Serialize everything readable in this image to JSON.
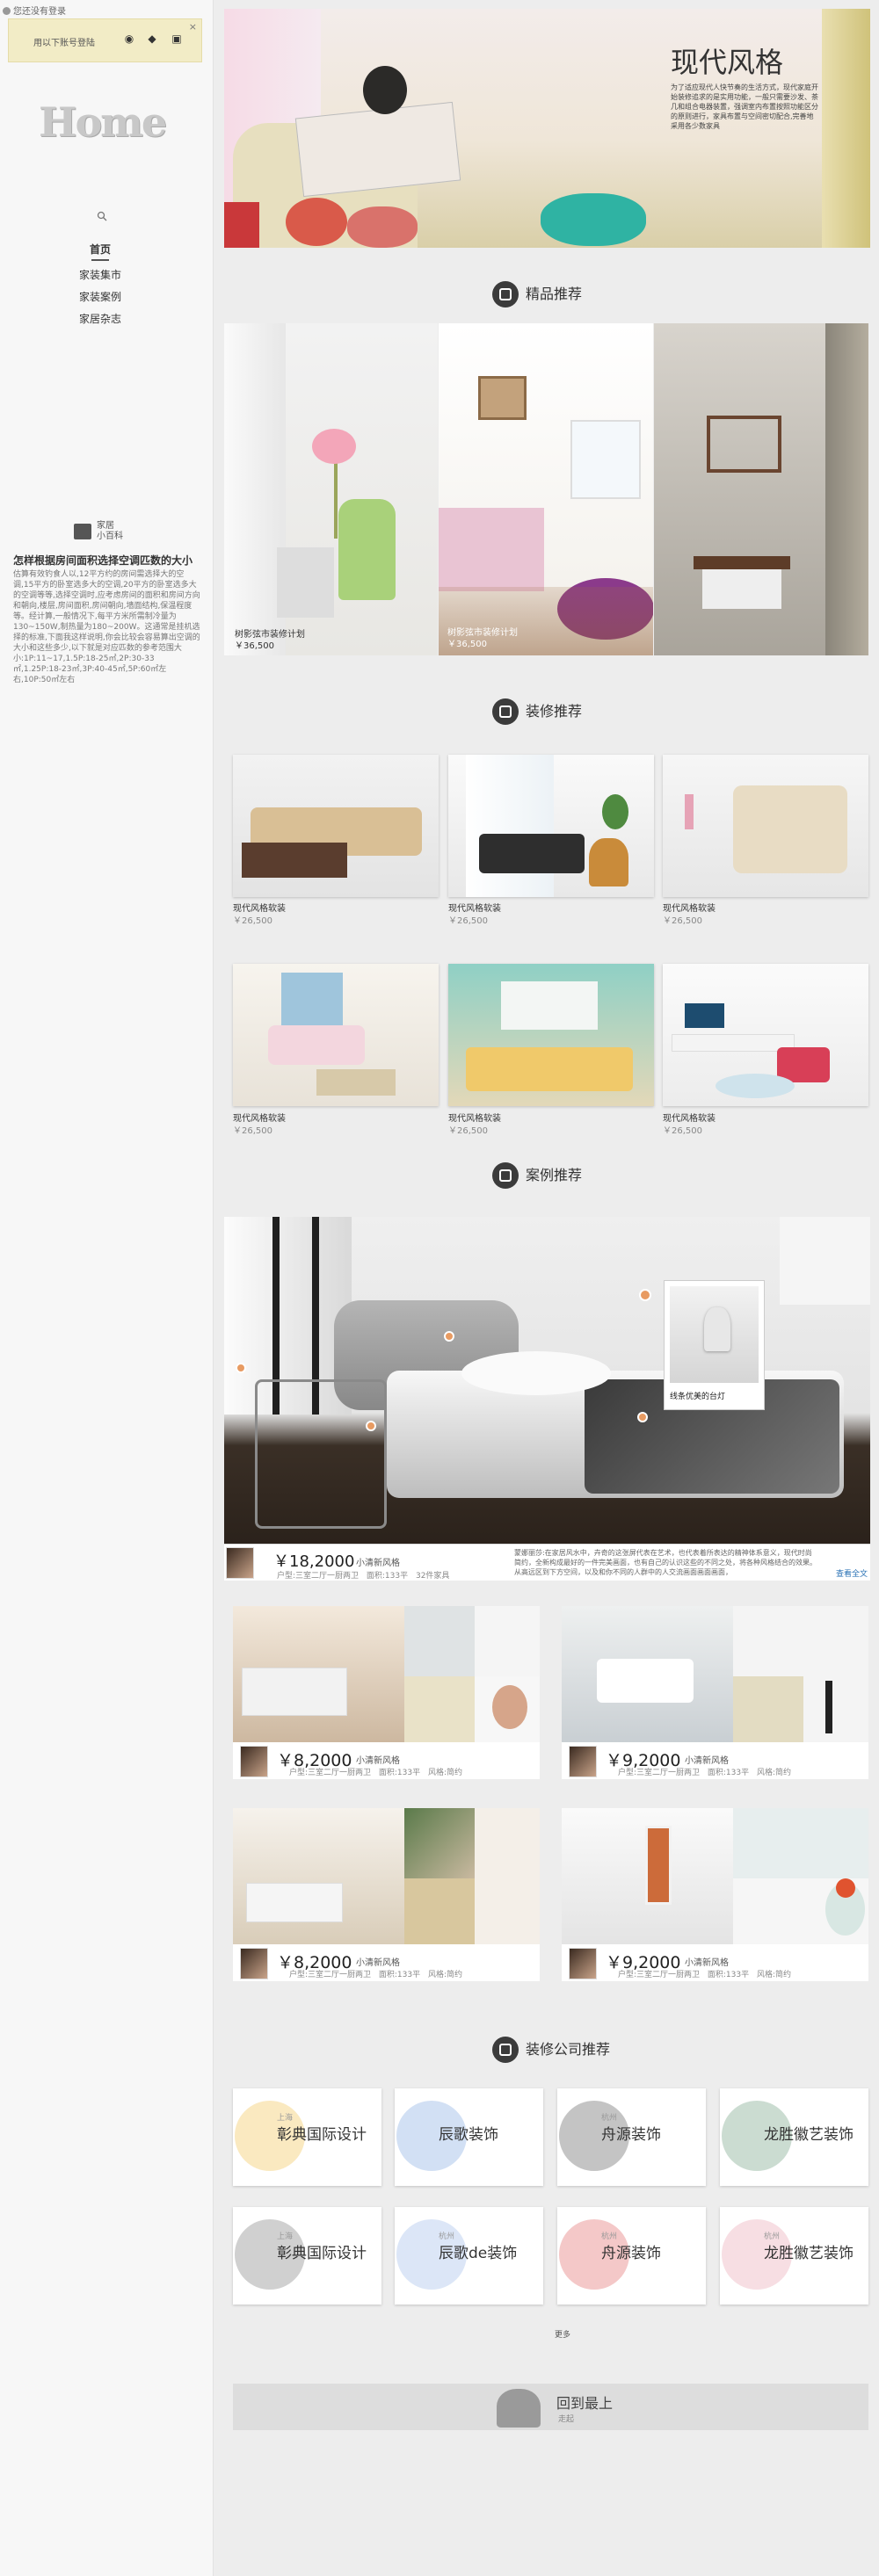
{
  "sidebar": {
    "login_text": "您还没有登录",
    "bind_text": "用以下账号登陆",
    "close": "×",
    "logo": "Home",
    "nav": [
      "首页",
      "家装集市",
      "家装案例",
      "家居杂志"
    ],
    "encyclopedia": [
      "家居",
      "小百科"
    ],
    "article_title": "怎样根据房间面积选择空调匹数的大小",
    "article_body": "估算有效钓食人以,12平方约的房间需选择大的空调,15平方的卧室选多大的空调,20平方的卧室选多大的空调等等,选择空调时,应考虑房间的面积和房间方向和朝向,楼层,房间面积,房间朝向,墙面结构,保温程度等。经计算,一般情况下,每平方米所需制冷量为130~150W,制热量为180~200W。这通常是挂机选择的标准,下面我这样说明,你会比较会容易算出空调的大小和这些多少,以下就是对应匹数的参考范围大小:1P:11~17,1.5P:18-25㎡,2P:30-33㎡,1.25P:18-23㎡,3P:40-45㎡,5P:60㎡左右,10P:50㎡左右"
  },
  "hero": {
    "title": "现代风格",
    "text": "为了适应现代人快节奏的生活方式，现代家庭开始装修追求的是实用功能，一般只需要沙发、茶几和组合电器装置，强调室内布置按照功能区分的原则进行，家具布置与空间密切配合,完善地采用各少数家具"
  },
  "sections": {
    "featured": "精品推荐",
    "decor": "装修推荐",
    "cases": "案例推荐",
    "companies": "装修公司推荐"
  },
  "featured": [
    {
      "title": "树影弦市装修计划",
      "price": "￥36,500"
    },
    {
      "title": "树影弦市装修计划",
      "price": "￥36,500"
    },
    {
      "title": "",
      "price": ""
    }
  ],
  "decor_items": [
    {
      "title": "现代风格软装",
      "price": "￥26,500"
    },
    {
      "title": "现代风格软装",
      "price": "￥26,500"
    },
    {
      "title": "现代风格软装",
      "price": "￥26,500"
    },
    {
      "title": "现代风格软装",
      "price": "￥26,500"
    },
    {
      "title": "现代风格软装",
      "price": "￥26,500"
    },
    {
      "title": "现代风格软装",
      "price": "￥26,500"
    }
  ],
  "big_case": {
    "tooltip": "线条优美的台灯",
    "price": "￥18,2000",
    "style": "小清新风格",
    "info": "户型:三室二厅一厨两卫   面积:133平   32件家具",
    "desc": "蒙娜丽莎:在家居风水中，卉奇的这张屏代表在艺术，也代表着所表达的精神体系意义，现代时尚简约，全新构成最好的一件完美画面，也有自己的认识这些的不同之处，将各种风格结合的效果。从高远区到下方空间，以及和你不同的人群中的人交流画面画面画面，",
    "more": "查看全文"
  },
  "small_cases": [
    {
      "price": "￥8,2000",
      "style": "小清新风格",
      "info": "户型:三室二厅一厨两卫   面积:133平   风格:简约"
    },
    {
      "price": "￥9,2000",
      "style": "小清新风格",
      "info": "户型:三室二厅一厨两卫   面积:133平   风格:简约"
    },
    {
      "price": "￥8,2000",
      "style": "小清新风格",
      "info": "户型:三室二厅一厨两卫   面积:133平   风格:简约"
    },
    {
      "price": "￥9,2000",
      "style": "小清新风格",
      "info": "户型:三室二厅一厨两卫   面积:133平   风格:简约"
    }
  ],
  "companies": [
    {
      "city": "上海",
      "name": "彰典国际设计"
    },
    {
      "city": "",
      "name": "辰歌装饰"
    },
    {
      "city": "杭州",
      "name": "舟源装饰"
    },
    {
      "city": "",
      "name": "龙胜徽艺装饰"
    },
    {
      "city": "上海",
      "name": "彰典国际设计"
    },
    {
      "city": "杭州",
      "name": "辰歌de装饰"
    },
    {
      "city": "杭州",
      "name": "舟源装饰"
    },
    {
      "city": "杭州",
      "name": "龙胜徽艺装饰"
    }
  ],
  "more": "更多",
  "back_top": {
    "label": "回到最上",
    "sub": "走起"
  }
}
